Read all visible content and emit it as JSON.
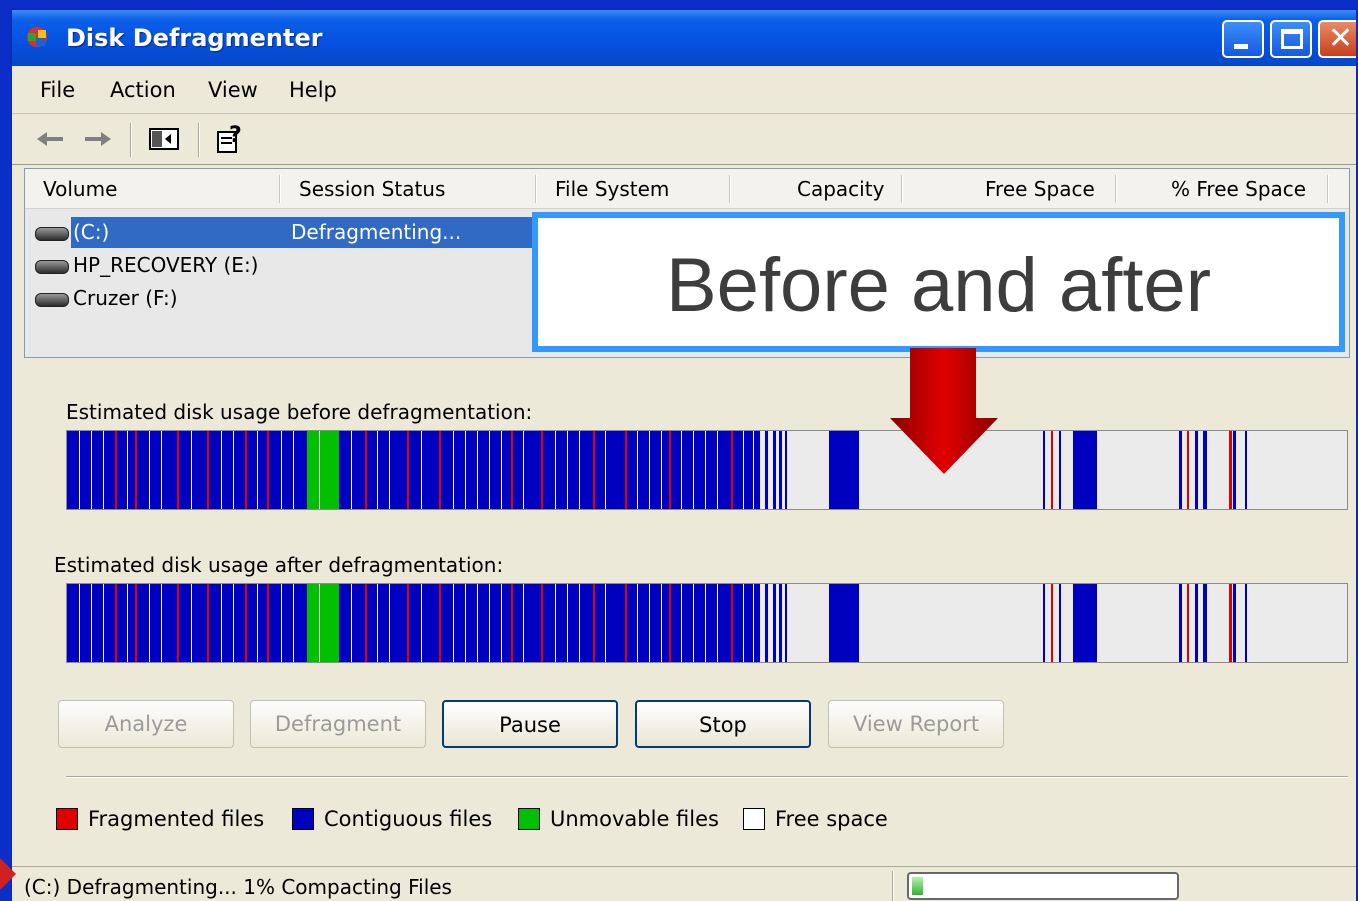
{
  "window": {
    "title": "Disk Defragmenter",
    "controls": {
      "minimize": "minimize-icon",
      "maximize": "maximize-icon",
      "close": "close-icon"
    }
  },
  "menu": [
    "File",
    "Action",
    "View",
    "Help"
  ],
  "toolbar": {
    "icons": [
      "back-arrow-icon",
      "forward-arrow-icon",
      "show-hide-console-tree-icon",
      "help-icon"
    ]
  },
  "list": {
    "columns": [
      "Volume",
      "Session Status",
      "File System",
      "Capacity",
      "Free Space",
      "% Free Space"
    ],
    "rows": [
      {
        "volume": "(C:)",
        "status": "Defragmenting...",
        "selected": true
      },
      {
        "volume": "HP_RECOVERY (E:)",
        "status": "",
        "selected": false
      },
      {
        "volume": "Cruzer (F:)",
        "status": "",
        "selected": false
      }
    ]
  },
  "overlay": {
    "text": "Before and after"
  },
  "before_label": "Estimated disk usage before defragmentation:",
  "after_label": "Estimated disk usage after defragmentation:",
  "buttons": {
    "analyze": "Analyze",
    "defragment": "Defragment",
    "pause": "Pause",
    "stop": "Stop",
    "view_report": "View Report"
  },
  "legend": {
    "fragmented": "Fragmented files",
    "contiguous": "Contiguous files",
    "unmovable": "Unmovable files",
    "free": "Free space"
  },
  "colors": {
    "fragmented": "#e00000",
    "contiguous": "#0000c0",
    "unmovable": "#00c000",
    "free": "#ffffff",
    "bar_background": "#ebebeb"
  },
  "statusbar": {
    "text": "(C:) Defragmenting... 1%  Compacting Files",
    "progress_percent": 1
  }
}
